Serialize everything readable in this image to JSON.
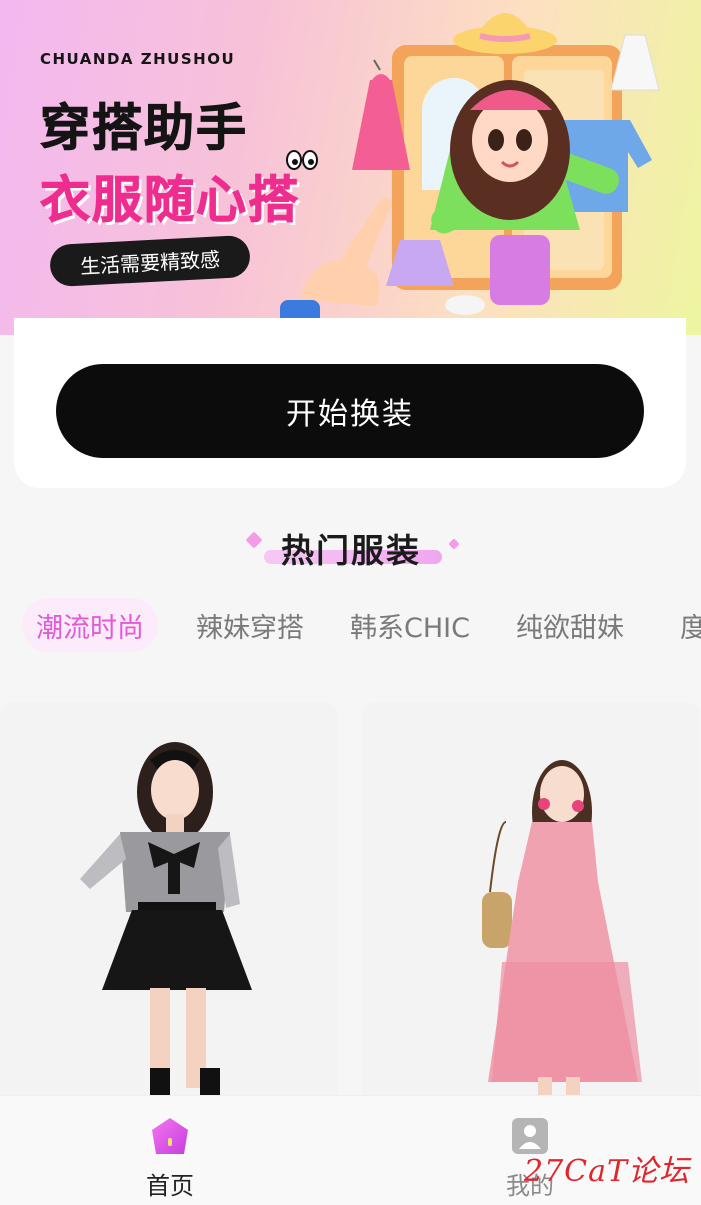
{
  "banner": {
    "brand_pinyin": "CHUANDA ZHUSHOU",
    "title_line1": "穿搭助手",
    "title_line2": "衣服随心搭",
    "tagline": "生活需要精致感"
  },
  "start_button_label": "开始换装",
  "section": {
    "title": "热门服装"
  },
  "tabs": [
    {
      "label": "潮流时尚",
      "active": true
    },
    {
      "label": "辣妹穿搭",
      "active": false
    },
    {
      "label": "韩系CHIC",
      "active": false
    },
    {
      "label": "纯欲甜妹",
      "active": false
    },
    {
      "label": "度",
      "active": false
    }
  ],
  "products": [
    {
      "style": "bow blouse with black skirt"
    },
    {
      "style": "pink floral slip dress"
    }
  ],
  "bottom_nav": {
    "home_label": "首页",
    "mine_label": "我的"
  },
  "watermark": "27CaT论坛",
  "colors": {
    "accent_pink": "#e35ad9",
    "button_black": "#0c0c0c",
    "title_pink": "#ee2d8e"
  }
}
